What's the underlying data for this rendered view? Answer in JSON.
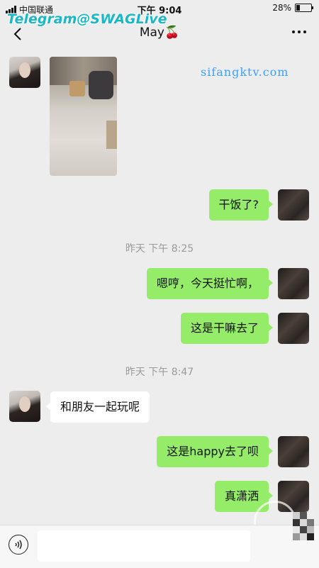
{
  "status": {
    "carrier": "中国联通",
    "time": "下午 9:04",
    "battery": "28%",
    "battery_level": 0.28
  },
  "watermarks": {
    "telegram": "Telegram@SWAGLive",
    "site": "sifangktv.com"
  },
  "header": {
    "title": "May🍒"
  },
  "messages": [
    {
      "from": "her",
      "type": "image"
    },
    {
      "from": "me",
      "text": "干饭了?"
    },
    {
      "type": "time",
      "text": "昨天 下午 8:25"
    },
    {
      "from": "me",
      "text": "嗯哼，今天挺忙啊，"
    },
    {
      "from": "me",
      "text": "这是干嘛去了"
    },
    {
      "type": "time",
      "text": "昨天 下午 8:47"
    },
    {
      "from": "her",
      "text": "和朋友一起玩呢"
    },
    {
      "from": "me",
      "text": "这是happy去了呗"
    },
    {
      "from": "me",
      "text": "真潇洒"
    }
  ],
  "icons": {
    "back": "chevron-left-icon",
    "more": "more-dots-icon",
    "voice": "voice-icon"
  }
}
